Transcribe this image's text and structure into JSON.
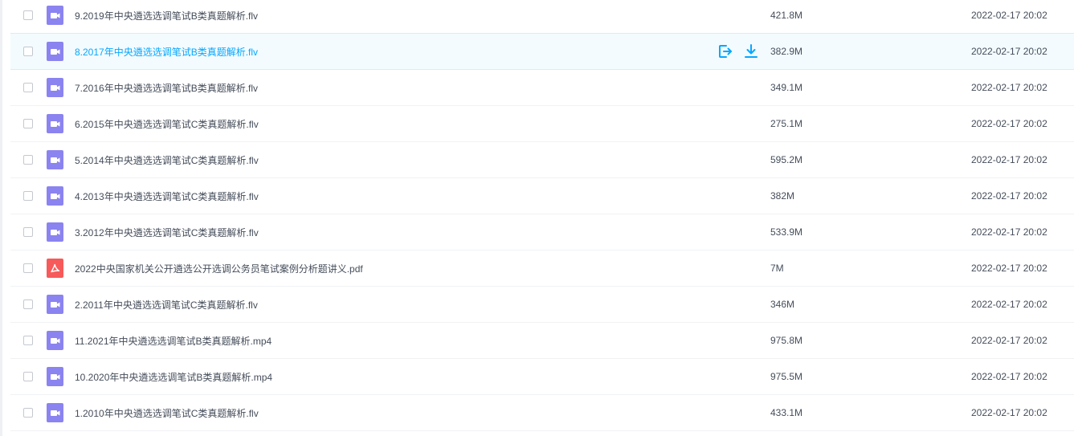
{
  "colors": {
    "accent": "#06a7ff",
    "video_icon": "#8b83f0",
    "pdf_icon": "#f75a5a",
    "text": "#454d5a"
  },
  "files": [
    {
      "name": "9.2019年中央遴选选调笔试B类真题解析.flv",
      "size": "421.8M",
      "date": "2022-02-17 20:02",
      "type": "video-icon",
      "active": false
    },
    {
      "name": "8.2017年中央遴选选调笔试B类真题解析.flv",
      "size": "382.9M",
      "date": "2022-02-17 20:02",
      "type": "video-icon",
      "active": true
    },
    {
      "name": "7.2016年中央遴选选调笔试B类真题解析.flv",
      "size": "349.1M",
      "date": "2022-02-17 20:02",
      "type": "video-icon",
      "active": false
    },
    {
      "name": "6.2015年中央遴选选调笔试C类真题解析.flv",
      "size": "275.1M",
      "date": "2022-02-17 20:02",
      "type": "video-icon",
      "active": false
    },
    {
      "name": "5.2014年中央遴选选调笔试C类真题解析.flv",
      "size": "595.2M",
      "date": "2022-02-17 20:02",
      "type": "video-icon",
      "active": false
    },
    {
      "name": "4.2013年中央遴选选调笔试C类真题解析.flv",
      "size": "382M",
      "date": "2022-02-17 20:02",
      "type": "video-icon",
      "active": false
    },
    {
      "name": "3.2012年中央遴选选调笔试C类真题解析.flv",
      "size": "533.9M",
      "date": "2022-02-17 20:02",
      "type": "video-icon",
      "active": false
    },
    {
      "name": "2022中央国家机关公开遴选公开选调公务员笔试案例分析题讲义.pdf",
      "size": "7M",
      "date": "2022-02-17 20:02",
      "type": "pdf-icon",
      "active": false
    },
    {
      "name": "2.2011年中央遴选选调笔试C类真题解析.flv",
      "size": "346M",
      "date": "2022-02-17 20:02",
      "type": "video-icon",
      "active": false
    },
    {
      "name": "11.2021年中央遴选选调笔试B类真题解析.mp4",
      "size": "975.8M",
      "date": "2022-02-17 20:02",
      "type": "video-icon",
      "active": false
    },
    {
      "name": "10.2020年中央遴选选调笔试B类真题解析.mp4",
      "size": "975.5M",
      "date": "2022-02-17 20:02",
      "type": "video-icon",
      "active": false
    },
    {
      "name": "1.2010年中央遴选选调笔试C类真题解析.flv",
      "size": "433.1M",
      "date": "2022-02-17 20:02",
      "type": "video-icon",
      "active": false
    }
  ]
}
